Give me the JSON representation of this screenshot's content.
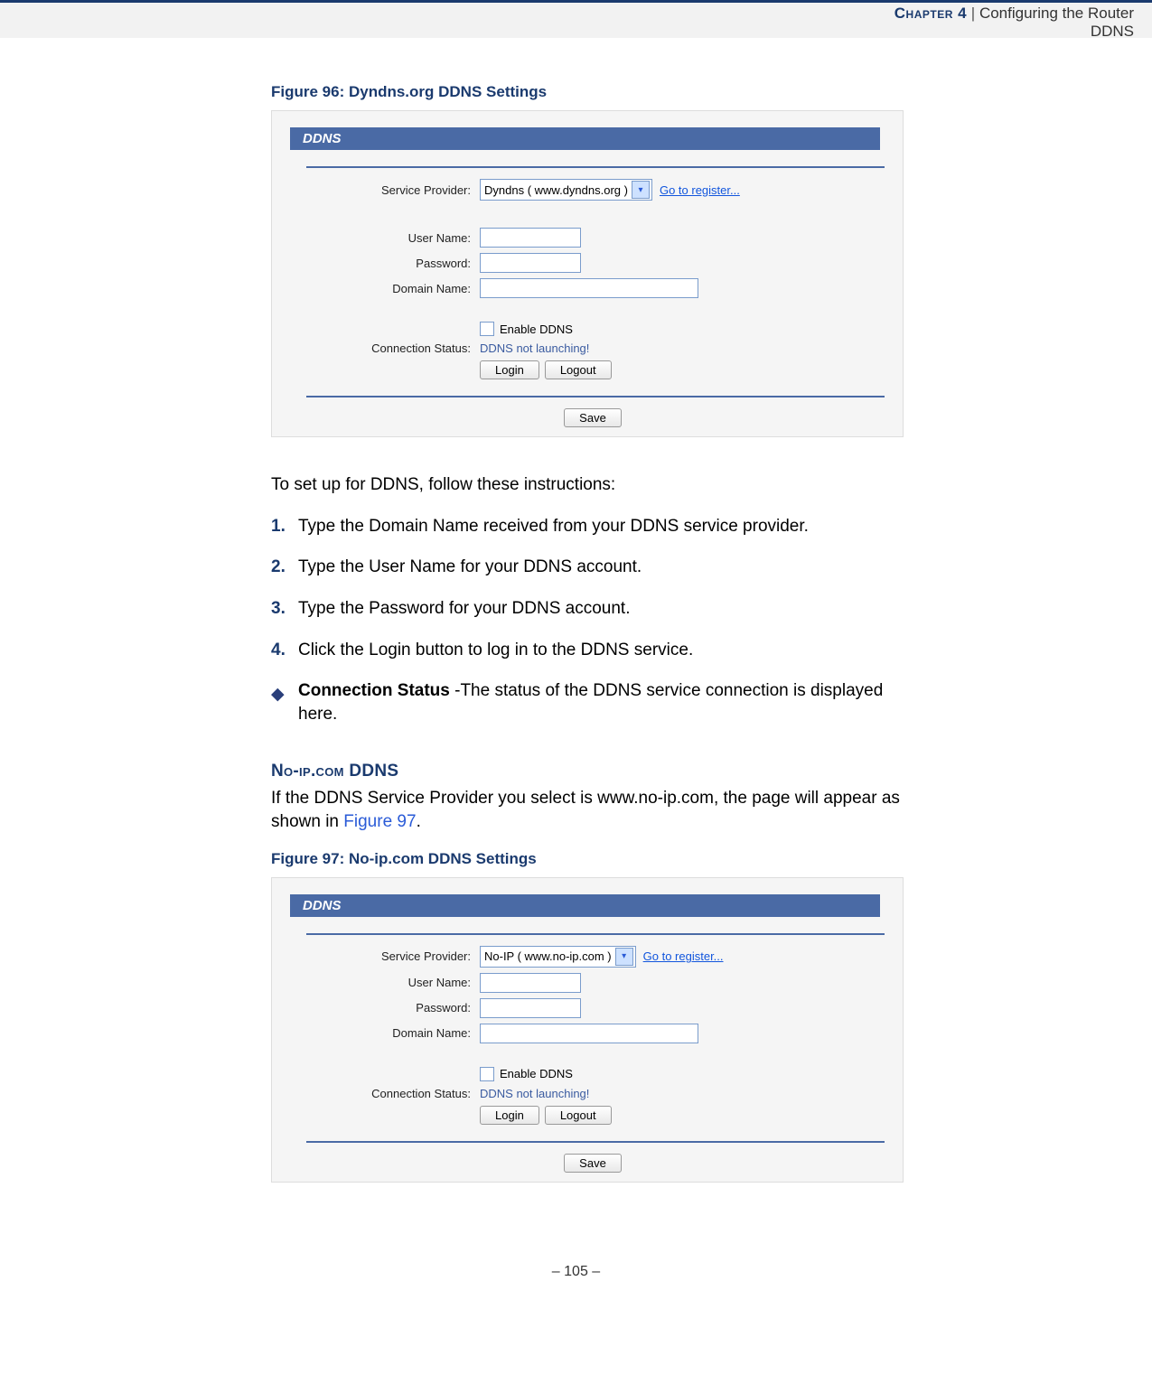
{
  "header": {
    "chapter": "Chapter 4",
    "separator": "|",
    "title": "Configuring the Router",
    "subtitle": "DDNS"
  },
  "fig96": {
    "caption": "Figure 96:  Dyndns.org DDNS Settings"
  },
  "fig97": {
    "caption": "Figure 97:  No-ip.com DDNS Settings"
  },
  "shot1": {
    "panel": "DDNS",
    "labels": {
      "service": "Service Provider:",
      "user": "User Name:",
      "pass": "Password:",
      "domain": "Domain Name:",
      "conn": "Connection Status:"
    },
    "provider_value": "Dyndns ( www.dyndns.org )",
    "register": "Go to register...",
    "enable": "Enable DDNS",
    "status": "DDNS not launching!",
    "login": "Login",
    "logout": "Logout",
    "save": "Save"
  },
  "shot2": {
    "panel": "DDNS",
    "labels": {
      "service": "Service Provider:",
      "user": "User Name:",
      "pass": "Password:",
      "domain": "Domain Name:",
      "conn": "Connection Status:"
    },
    "provider_value": "No-IP ( www.no-ip.com )",
    "register": "Go to register...",
    "enable": "Enable DDNS",
    "status": "DDNS not launching!",
    "login": "Login",
    "logout": "Logout",
    "save": "Save"
  },
  "text": {
    "intro": "To set up for DDNS, follow these instructions:",
    "s1": "Type the Domain Name received from your DDNS service provider.",
    "s2": "Type the User Name for your DDNS account.",
    "s3": "Type the Password for your DDNS account.",
    "s4": "Click the Login button to log in to the DDNS service.",
    "bullet_label": "Connection Status",
    "bullet_rest": " -The status of the DDNS service connection is displayed here.",
    "sect": "No-ip.com DDNS",
    "noip_p_a": "If the DDNS Service Provider you select is www.no-ip.com, the page will appear as shown in ",
    "noip_xref": "Figure 97",
    "noip_p_b": ".",
    "n1": "1.",
    "n2": "2.",
    "n3": "3.",
    "n4": "4."
  },
  "footer": {
    "page": "–  105  –"
  }
}
